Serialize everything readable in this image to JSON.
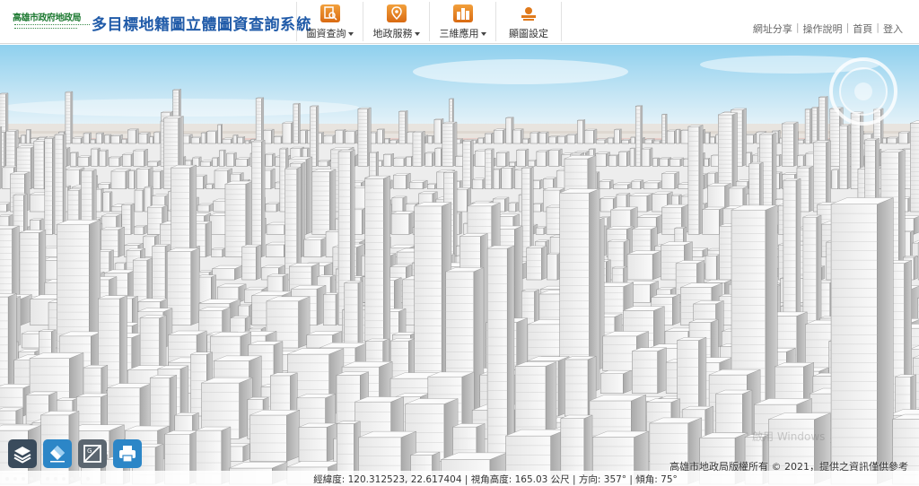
{
  "header": {
    "org_name": "高雄市政府地政局",
    "app_title": "多目標地籍圖立體圖資查詢系統"
  },
  "menu": [
    {
      "label": "圖資查詢",
      "icon": "search-document-icon",
      "has_dropdown": true
    },
    {
      "label": "地政服務",
      "icon": "map-pin-icon",
      "has_dropdown": true
    },
    {
      "label": "三維應用",
      "icon": "buildings-icon",
      "has_dropdown": true
    },
    {
      "label": "顯圖設定",
      "icon": "display-settings-icon",
      "has_dropdown": false
    }
  ],
  "top_links": [
    "網址分享",
    "操作說明",
    "首頁",
    "登入"
  ],
  "tools": [
    {
      "name": "layers",
      "icon": "layers-icon"
    },
    {
      "name": "draw",
      "icon": "eraser-icon"
    },
    {
      "name": "measure",
      "icon": "measure-icon"
    },
    {
      "name": "print",
      "icon": "printer-icon"
    }
  ],
  "copyright": "高雄市地政局版權所有 © 2021，提供之資訊僅供參考",
  "watermark": "啟用 Windows",
  "status": "經緯度: 120.312523, 22.617404 | 視角高度: 165.03 公尺 | 方向: 357° | 傾角: 75°",
  "colors": {
    "title_blue": "#1f5aa8",
    "menu_orange": "#e07a1c",
    "sky_top": "#8fd0ee",
    "building_white": "#f0f0f0"
  }
}
